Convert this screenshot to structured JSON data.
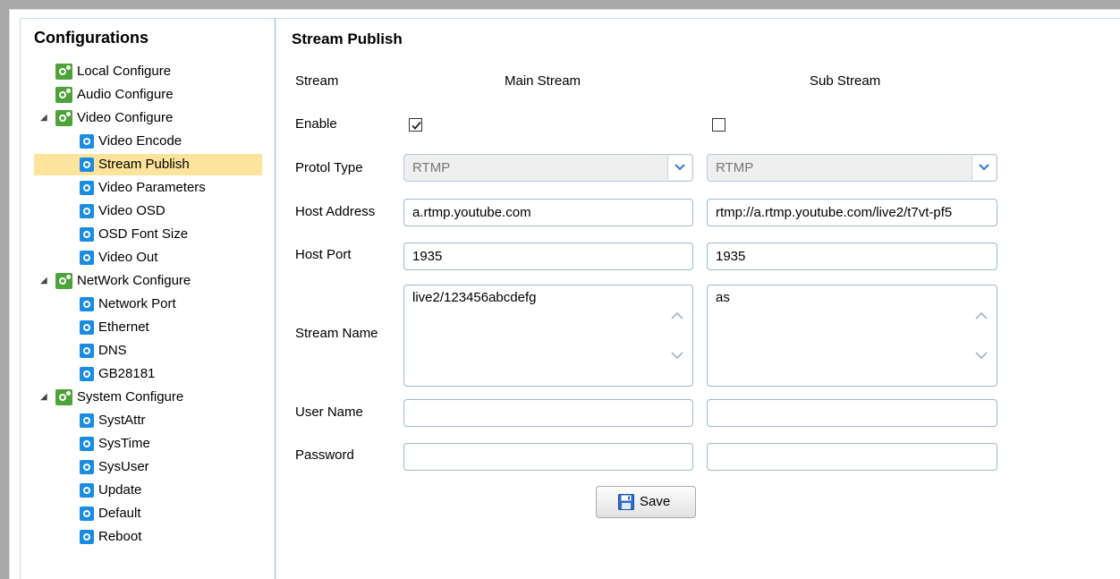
{
  "sidebar": {
    "title": "Configurations",
    "items": [
      {
        "label": "Local Configure",
        "level": 0,
        "icon": "gear-green-icon"
      },
      {
        "label": "Audio Configure",
        "level": 0,
        "icon": "gear-green-icon"
      },
      {
        "label": "Video Configure",
        "level": 0,
        "icon": "gear-green-icon",
        "expanded": true
      },
      {
        "label": "Video Encode",
        "level": 1,
        "icon": "gear-blue-icon"
      },
      {
        "label": "Stream Publish",
        "level": 1,
        "icon": "gear-blue-icon",
        "selected": true
      },
      {
        "label": "Video Parameters",
        "level": 1,
        "icon": "gear-blue-icon"
      },
      {
        "label": "Video OSD",
        "level": 1,
        "icon": "gear-blue-icon"
      },
      {
        "label": "OSD Font Size",
        "level": 1,
        "icon": "gear-blue-icon"
      },
      {
        "label": "Video Out",
        "level": 1,
        "icon": "gear-blue-icon"
      },
      {
        "label": "NetWork Configure",
        "level": 0,
        "icon": "gear-green-icon",
        "expanded": true
      },
      {
        "label": "Network Port",
        "level": 1,
        "icon": "gear-blue-icon"
      },
      {
        "label": "Ethernet",
        "level": 1,
        "icon": "gear-blue-icon"
      },
      {
        "label": "DNS",
        "level": 1,
        "icon": "gear-blue-icon"
      },
      {
        "label": "GB28181",
        "level": 1,
        "icon": "gear-blue-icon"
      },
      {
        "label": "System Configure",
        "level": 0,
        "icon": "gear-green-icon",
        "expanded": true
      },
      {
        "label": "SystAttr",
        "level": 1,
        "icon": "gear-blue-icon"
      },
      {
        "label": "SysTime",
        "level": 1,
        "icon": "gear-blue-icon"
      },
      {
        "label": "SysUser",
        "level": 1,
        "icon": "gear-blue-icon"
      },
      {
        "label": "Update",
        "level": 1,
        "icon": "gear-blue-icon"
      },
      {
        "label": "Default",
        "level": 1,
        "icon": "gear-blue-icon"
      },
      {
        "label": "Reboot",
        "level": 1,
        "icon": "gear-blue-icon"
      }
    ]
  },
  "main": {
    "title": "Stream Publish",
    "labels": {
      "stream": "Stream",
      "enable": "Enable",
      "protocol_type": "Protol Type",
      "host_address": "Host Address",
      "host_port": "Host Port",
      "stream_name": "Stream Name",
      "user_name": "User Name",
      "password": "Password"
    },
    "main_stream": {
      "header": "Main Stream",
      "enabled": true,
      "protocol": "RTMP",
      "host_address": "a.rtmp.youtube.com",
      "host_port": "1935",
      "stream_name": "live2/123456abcdefg",
      "user_name": "",
      "password": ""
    },
    "sub_stream": {
      "header": "Sub Stream",
      "enabled": false,
      "protocol": "RTMP",
      "host_address": "rtmp://a.rtmp.youtube.com/live2/t7vt-pf5",
      "host_port": "1935",
      "stream_name": "as",
      "user_name": "",
      "password": ""
    },
    "save_label": "Save"
  },
  "colors": {
    "selected_bg": "#fde49c",
    "border_blue": "#9fb7d6",
    "gear_green": "#4ea23a",
    "gear_blue": "#1a8de3"
  }
}
